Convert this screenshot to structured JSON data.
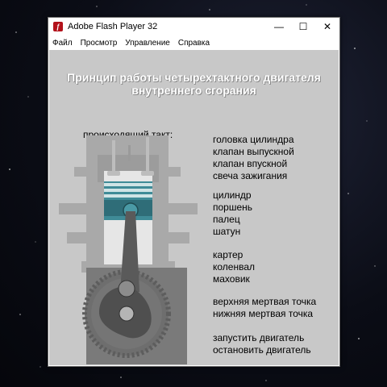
{
  "window": {
    "title": "Adobe Flash Player 32",
    "controls": {
      "minimize": "—",
      "maximize": "☐",
      "close": "✕"
    }
  },
  "menu": [
    "Файл",
    "Просмотр",
    "Управление",
    "Справка"
  ],
  "stage": {
    "title_line1": "Принцип работы четырехтактного двигателя",
    "title_line2": "внутреннего сгорания",
    "stroke_label": "происходящий такт:",
    "group1": [
      "головка цилиндра",
      "клапан выпускной",
      "клапан впускной",
      "свеча зажигания"
    ],
    "group2": [
      "цилиндр",
      "поршень",
      "палец",
      "шатун"
    ],
    "group3": [
      "картер",
      "коленвал",
      "маховик"
    ],
    "group4": [
      "верхняя мертвая точка",
      "нижняя мертвая точка"
    ],
    "group5": [
      "запустить двигатель",
      "остановить двигатель"
    ]
  },
  "colors": {
    "stage_bg": "#c8c8c8",
    "engine_gray": "#a9a9a9",
    "crankcase": "#555555",
    "flywheel": "#6e6e6e",
    "piston": "#3f8b97"
  }
}
